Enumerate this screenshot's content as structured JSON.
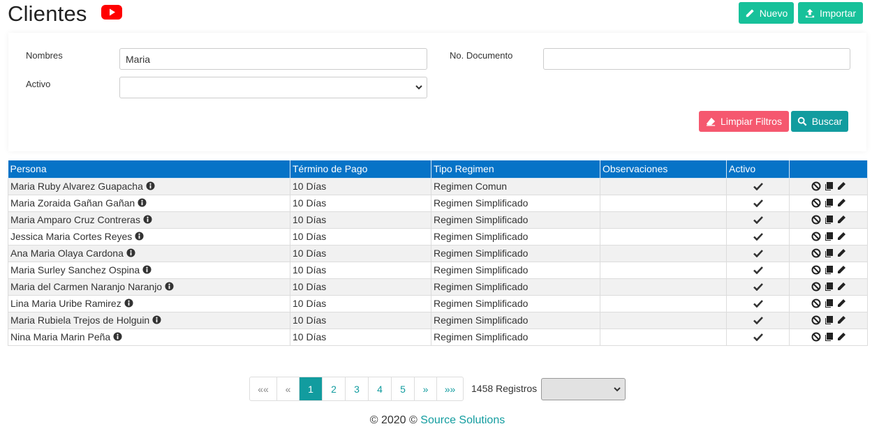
{
  "header": {
    "title": "Clientes",
    "new_label": "Nuevo",
    "import_label": "Importar"
  },
  "filters": {
    "nombres_label": "Nombres",
    "nombres_value": "Maria",
    "documento_label": "No. Documento",
    "documento_value": "",
    "activo_label": "Activo",
    "activo_value": "",
    "clear_label": "Limpiar Filtros",
    "search_label": "Buscar"
  },
  "table": {
    "columns": [
      "Persona",
      "Término de Pago",
      "Tipo Regimen",
      "Observaciones",
      "Activo",
      ""
    ],
    "rows": [
      {
        "persona": "Maria Ruby Alvarez Guapacha",
        "termino": "10 Días",
        "regimen": "Regimen Comun",
        "observaciones": ""
      },
      {
        "persona": "Maria Zoraida Gañan Gañan",
        "termino": "10 Días",
        "regimen": "Regimen Simplificado",
        "observaciones": ""
      },
      {
        "persona": "Maria Amparo Cruz Contreras",
        "termino": "10 Días",
        "regimen": "Regimen Simplificado",
        "observaciones": ""
      },
      {
        "persona": "Jessica Maria Cortes Reyes",
        "termino": "10 Días",
        "regimen": "Regimen Simplificado",
        "observaciones": ""
      },
      {
        "persona": "Ana Maria Olaya Cardona",
        "termino": "10 Días",
        "regimen": "Regimen Simplificado",
        "observaciones": ""
      },
      {
        "persona": "Maria Surley Sanchez Ospina",
        "termino": "10 Días",
        "regimen": "Regimen Simplificado",
        "observaciones": ""
      },
      {
        "persona": "Maria del Carmen Naranjo Naranjo",
        "termino": "10 Días",
        "regimen": "Regimen Simplificado",
        "observaciones": ""
      },
      {
        "persona": "Lina Maria Uribe Ramirez",
        "termino": "10 Días",
        "regimen": "Regimen Simplificado",
        "observaciones": ""
      },
      {
        "persona": "Maria Rubiela Trejos de Holguin",
        "termino": "10 Días",
        "regimen": "Regimen Simplificado",
        "observaciones": ""
      },
      {
        "persona": "Nina Maria Marin Peña",
        "termino": "10 Días",
        "regimen": "Regimen Simplificado",
        "observaciones": ""
      }
    ]
  },
  "pagination": {
    "first": "««",
    "prev": "«",
    "pages": [
      "1",
      "2",
      "3",
      "4",
      "5"
    ],
    "current": "1",
    "next": "»",
    "last": "»»",
    "records_text": "1458 Registros",
    "page_size_value": ""
  },
  "footer": {
    "prefix": "© 2020 ©",
    "link": "Source Solutions"
  },
  "colors": {
    "accent": "#129c9f",
    "header_blue": "#0673c7",
    "green": "#17c19a",
    "red": "#f5586f"
  },
  "icons": [
    "youtube-icon",
    "pencil-icon",
    "upload-icon",
    "eraser-icon",
    "search-icon",
    "info-icon",
    "check-icon",
    "ban-icon",
    "copy-icon",
    "edit-icon"
  ]
}
